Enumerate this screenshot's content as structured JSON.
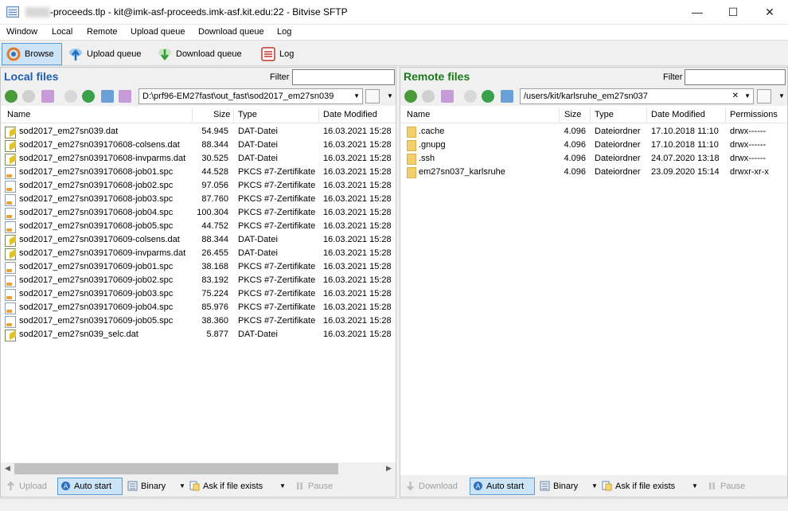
{
  "window": {
    "title": "-proceeds.tlp - kit@imk-asf-proceeds.imk-asf.kit.edu:22 - Bitvise SFTP",
    "minimize": "—",
    "maximize": "☐",
    "close": "✕"
  },
  "menu": [
    "Window",
    "Local",
    "Remote",
    "Upload queue",
    "Download queue",
    "Log"
  ],
  "toolbar": {
    "browse": "Browse",
    "upload_queue": "Upload queue",
    "download_queue": "Download queue",
    "log": "Log"
  },
  "local": {
    "title": "Local files",
    "filter_label": "Filter",
    "filter_value": "",
    "path": "D:\\prf96-EM27fast\\out_fast\\sod2017_em27sn039",
    "columns": [
      "Name",
      "Size",
      "Type",
      "Date Modified"
    ],
    "files": [
      {
        "name": "sod2017_em27sn039.dat",
        "size": "54.945",
        "type": "DAT-Datei",
        "date": "16.03.2021 15:28",
        "icon": "dat"
      },
      {
        "name": "sod2017_em27sn039170608-colsens.dat",
        "size": "88.344",
        "type": "DAT-Datei",
        "date": "16.03.2021 15:28",
        "icon": "dat"
      },
      {
        "name": "sod2017_em27sn039170608-invparms.dat",
        "size": "30.525",
        "type": "DAT-Datei",
        "date": "16.03.2021 15:28",
        "icon": "dat"
      },
      {
        "name": "sod2017_em27sn039170608-job01.spc",
        "size": "44.528",
        "type": "PKCS #7-Zertifikate",
        "date": "16.03.2021 15:28",
        "icon": "spc"
      },
      {
        "name": "sod2017_em27sn039170608-job02.spc",
        "size": "97.056",
        "type": "PKCS #7-Zertifikate",
        "date": "16.03.2021 15:28",
        "icon": "spc"
      },
      {
        "name": "sod2017_em27sn039170608-job03.spc",
        "size": "87.760",
        "type": "PKCS #7-Zertifikate",
        "date": "16.03.2021 15:28",
        "icon": "spc"
      },
      {
        "name": "sod2017_em27sn039170608-job04.spc",
        "size": "100.304",
        "type": "PKCS #7-Zertifikate",
        "date": "16.03.2021 15:28",
        "icon": "spc"
      },
      {
        "name": "sod2017_em27sn039170608-job05.spc",
        "size": "44.752",
        "type": "PKCS #7-Zertifikate",
        "date": "16.03.2021 15:28",
        "icon": "spc"
      },
      {
        "name": "sod2017_em27sn039170609-colsens.dat",
        "size": "88.344",
        "type": "DAT-Datei",
        "date": "16.03.2021 15:28",
        "icon": "dat"
      },
      {
        "name": "sod2017_em27sn039170609-invparms.dat",
        "size": "26.455",
        "type": "DAT-Datei",
        "date": "16.03.2021 15:28",
        "icon": "dat"
      },
      {
        "name": "sod2017_em27sn039170609-job01.spc",
        "size": "38.168",
        "type": "PKCS #7-Zertifikate",
        "date": "16.03.2021 15:28",
        "icon": "spc"
      },
      {
        "name": "sod2017_em27sn039170609-job02.spc",
        "size": "83.192",
        "type": "PKCS #7-Zertifikate",
        "date": "16.03.2021 15:28",
        "icon": "spc"
      },
      {
        "name": "sod2017_em27sn039170609-job03.spc",
        "size": "75.224",
        "type": "PKCS #7-Zertifikate",
        "date": "16.03.2021 15:28",
        "icon": "spc"
      },
      {
        "name": "sod2017_em27sn039170609-job04.spc",
        "size": "85.976",
        "type": "PKCS #7-Zertifikate",
        "date": "16.03.2021 15:28",
        "icon": "spc"
      },
      {
        "name": "sod2017_em27sn039170609-job05.spc",
        "size": "38.360",
        "type": "PKCS #7-Zertifikate",
        "date": "16.03.2021 15:28",
        "icon": "spc"
      },
      {
        "name": "sod2017_em27sn039_selc.dat",
        "size": "5.877",
        "type": "DAT-Datei",
        "date": "16.03.2021 15:28",
        "icon": "dat"
      }
    ],
    "bottom": {
      "upload": "Upload",
      "auto_start": "Auto start",
      "binary": "Binary",
      "ask": "Ask if file exists",
      "pause": "Pause"
    }
  },
  "remote": {
    "title": "Remote files",
    "filter_label": "Filter",
    "filter_value": "",
    "path": "/users/kit/karlsruhe_em27sn037",
    "columns": [
      "Name",
      "Size",
      "Type",
      "Date Modified",
      "Permissions"
    ],
    "files": [
      {
        "name": ".cache",
        "size": "4.096",
        "type": "Dateiordner",
        "date": "17.10.2018 11:10",
        "perm": "drwx------"
      },
      {
        "name": ".gnupg",
        "size": "4.096",
        "type": "Dateiordner",
        "date": "17.10.2018 11:10",
        "perm": "drwx------"
      },
      {
        "name": ".ssh",
        "size": "4.096",
        "type": "Dateiordner",
        "date": "24.07.2020 13:18",
        "perm": "drwx------"
      },
      {
        "name": "em27sn037_karlsruhe",
        "size": "4.096",
        "type": "Dateiordner",
        "date": "23.09.2020 15:14",
        "perm": "drwxr-xr-x"
      }
    ],
    "bottom": {
      "download": "Download",
      "auto_start": "Auto start",
      "binary": "Binary",
      "ask": "Ask if file exists",
      "pause": "Pause"
    }
  },
  "colors": {
    "local_title": "#1f5fb4",
    "remote_title": "#1a7a1a",
    "selected": "#cce4f7"
  }
}
